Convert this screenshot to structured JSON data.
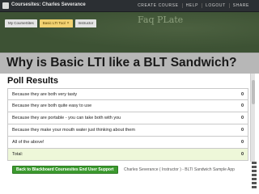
{
  "topbar": {
    "title": "Coursesites: Charles Severance",
    "nav": [
      "CREATE COURSE",
      "HELP",
      "LOGOUT",
      "SHARE"
    ]
  },
  "tabs": [
    {
      "label": "My CourseSites",
      "active": false
    },
    {
      "label": "Basic LTI Tool",
      "active": true
    },
    {
      "label": "Instructor",
      "active": false
    }
  ],
  "header": {
    "chalk_text": "Faq   PLate"
  },
  "page": {
    "title": "Why is Basic LTI like a BLT Sandwich?"
  },
  "poll": {
    "heading": "Poll Results",
    "rows": [
      {
        "label": "Because they are both very tasty",
        "count": "0"
      },
      {
        "label": "Because they are both quite easy to use",
        "count": "0"
      },
      {
        "label": "Because they are portable - you can take both with you",
        "count": "0"
      },
      {
        "label": "Because they make your mouth water just thinking about them",
        "count": "0"
      },
      {
        "label": "All of the above!",
        "count": "0"
      }
    ],
    "total": {
      "label": "Total:",
      "count": "0"
    }
  },
  "footer": {
    "back_label": "Back to Blackboard Coursesites End User Support",
    "info": "Charles Severance ( Instructor ) - BLTI Sandwich Sample App"
  },
  "colors": {
    "topbar": "#2b2f33",
    "board": "#3d5234",
    "title_strip": "#b7b7b7",
    "active_tab": "#f2d272",
    "total_row": "#eef7d9",
    "button": "#3c9a2f"
  }
}
